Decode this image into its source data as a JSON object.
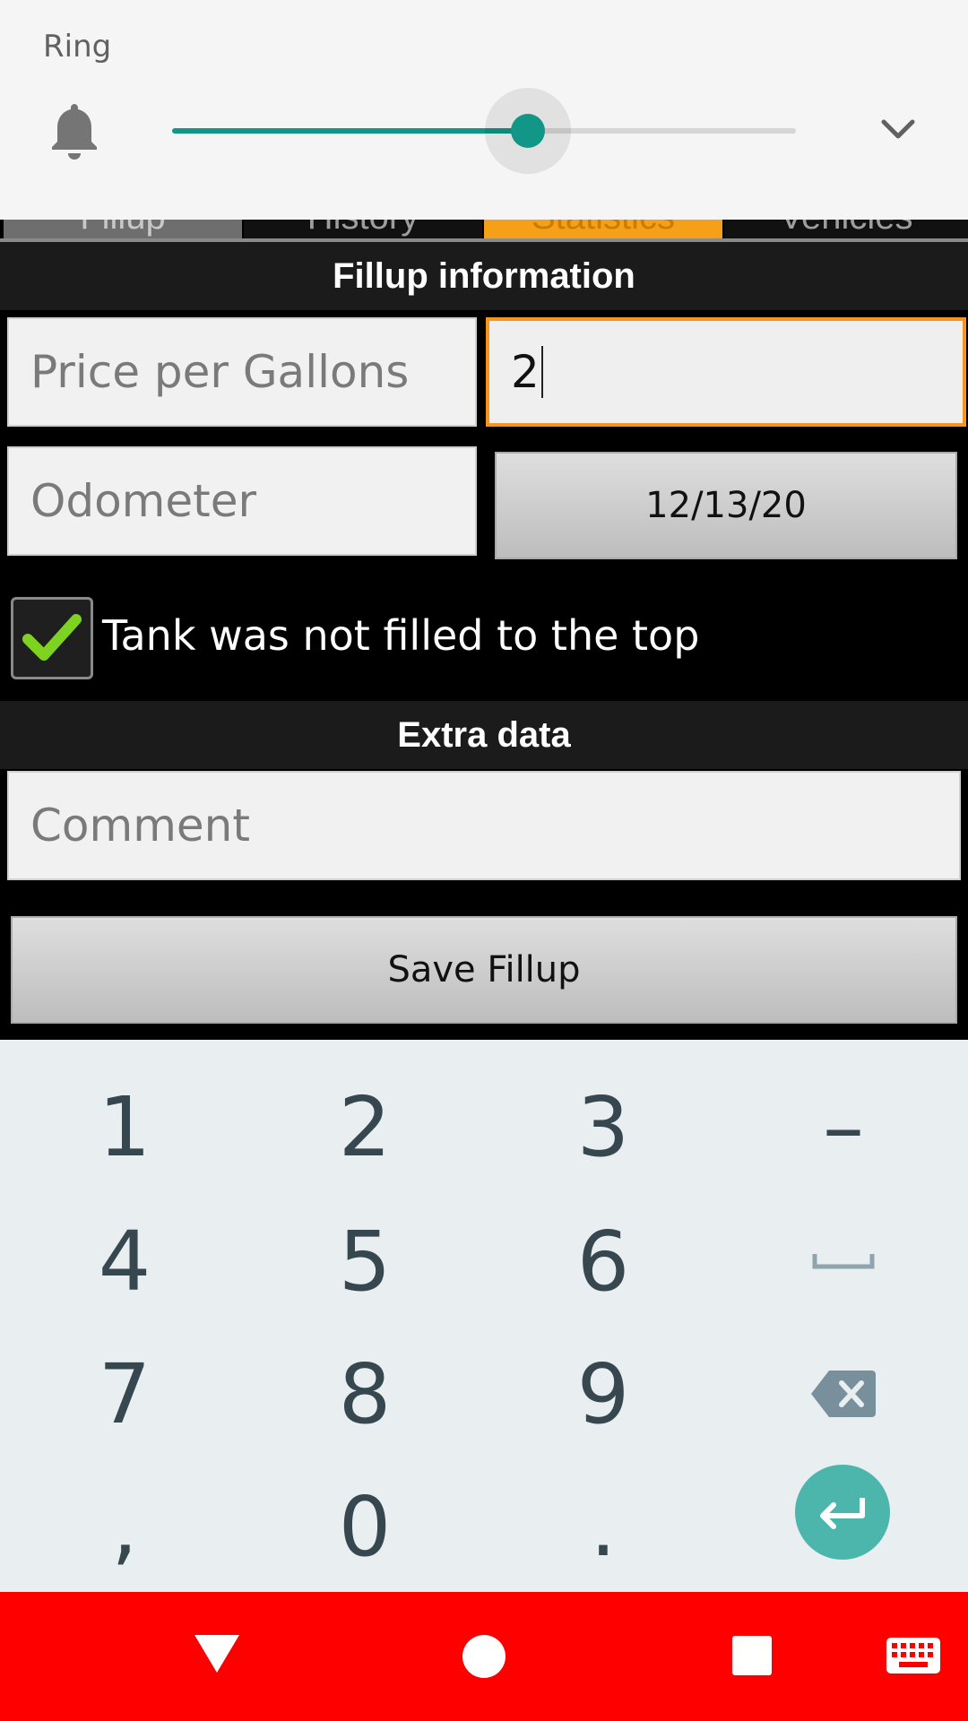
{
  "volume_panel": {
    "label": "Ring",
    "level_fraction": 0.57,
    "accent": "#129688",
    "icons": {
      "bell": "bell-icon",
      "expand": "chevron-down-icon"
    }
  },
  "tabs": [
    {
      "label": "Fillup",
      "selected": false
    },
    {
      "label": "History",
      "selected": false
    },
    {
      "label": "Statistics",
      "selected": true
    },
    {
      "label": "Vehicles",
      "selected": false
    }
  ],
  "fillup_section": {
    "title": "Fillup information",
    "price_placeholder": "Price per Gallons",
    "gallons_value": "2",
    "odometer_placeholder": "Odometer",
    "date_button": "12/13/20",
    "partial_fill_label": "Tank was not filled to the top",
    "partial_fill_checked": true
  },
  "extra_section": {
    "title": "Extra data",
    "comment_placeholder": "Comment",
    "save_button": "Save Fillup"
  },
  "keyboard": {
    "rows": [
      [
        "1",
        "2",
        "3",
        "–"
      ],
      [
        "4",
        "5",
        "6",
        "space"
      ],
      [
        "7",
        "8",
        "9",
        "backspace"
      ],
      [
        ",",
        "0",
        ".",
        "enter"
      ]
    ],
    "enter_color": "#4db6ac"
  },
  "navbar": {
    "color": "#ff0000",
    "icons": [
      "back-icon",
      "home-icon",
      "recents-icon",
      "keyboard-icon"
    ]
  }
}
